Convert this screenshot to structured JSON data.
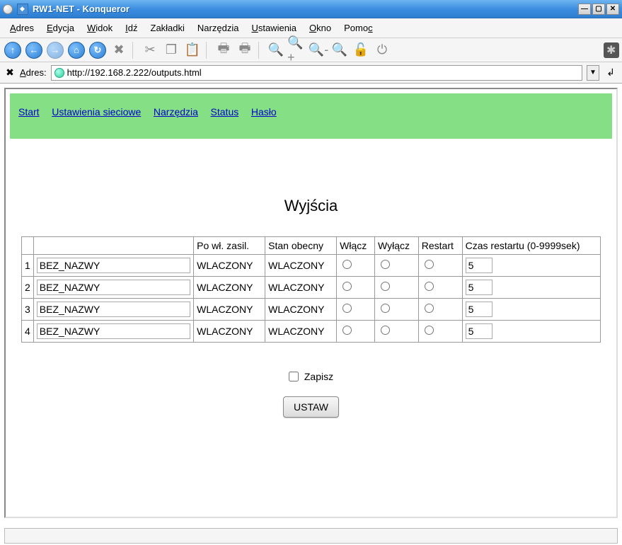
{
  "window": {
    "title": "RW1-NET - Konqueror"
  },
  "menus": {
    "adres": "Adres",
    "edycja": "Edycja",
    "widok": "Widok",
    "idz": "Idź",
    "zakladki": "Zakładki",
    "narzedzia": "Narzędzia",
    "ustawienia": "Ustawienia",
    "okno": "Okno",
    "pomoc": "Pomoc"
  },
  "address": {
    "label": "Adres:",
    "url": "http://192.168.2.222/outputs.html"
  },
  "nav": {
    "start": "Start",
    "ustawienia_sieciowe": "Ustawienia sieciowe",
    "narzedzia": "Narzędzia",
    "status": "Status",
    "haslo": "Hasło"
  },
  "page": {
    "title": "Wyjścia",
    "headers": {
      "po_wl_zasil": "Po wł. zasil.",
      "stan_obecny": "Stan obecny",
      "wlacz": "Włącz",
      "wylacz": "Wyłącz",
      "restart": "Restart",
      "czas_restartu": "Czas restartu (0-9999sek)"
    },
    "rows": [
      {
        "idx": "1",
        "name": "BEZ_NAZWY",
        "po_wl": "WLACZONY",
        "stan": "WLACZONY",
        "rt": "5"
      },
      {
        "idx": "2",
        "name": "BEZ_NAZWY",
        "po_wl": "WLACZONY",
        "stan": "WLACZONY",
        "rt": "5"
      },
      {
        "idx": "3",
        "name": "BEZ_NAZWY",
        "po_wl": "WLACZONY",
        "stan": "WLACZONY",
        "rt": "5"
      },
      {
        "idx": "4",
        "name": "BEZ_NAZWY",
        "po_wl": "WLACZONY",
        "stan": "WLACZONY",
        "rt": "5"
      }
    ],
    "zapisz_label": "Zapisz",
    "submit_label": "USTAW"
  }
}
